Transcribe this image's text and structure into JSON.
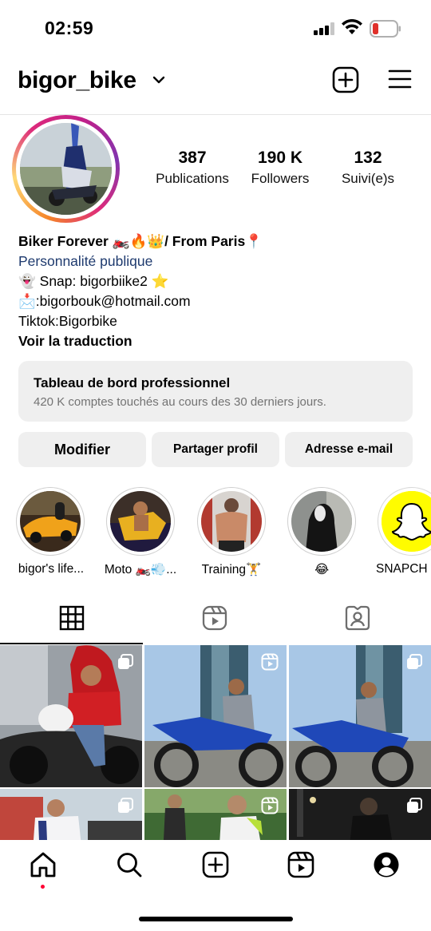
{
  "status_bar": {
    "time": "02:59"
  },
  "header": {
    "username": "bigor_bike"
  },
  "stats": [
    {
      "value": "387",
      "label": "Publications"
    },
    {
      "value": "190 K",
      "label": "Followers"
    },
    {
      "value": "132",
      "label": "Suivi(e)s"
    }
  ],
  "bio": {
    "name_line": "Biker Forever 🏍️🔥👑/ From Paris📍",
    "category": "Personnalité publique",
    "snap_line": "👻 Snap: bigorbiike2 ⭐",
    "email_line": "📩:bigorbouk@hotmail.com",
    "tiktok_line": "Tiktok:Bigorbike",
    "translate": "Voir la traduction"
  },
  "dashboard": {
    "title": "Tableau de bord professionnel",
    "subtitle": "420 K comptes touchés au cours des 30 derniers jours."
  },
  "buttons": {
    "edit": "Modifier",
    "share": "Partager profil",
    "email": "Adresse e-mail"
  },
  "highlights": [
    {
      "label": "bigor's life..."
    },
    {
      "label": "Moto 🏍️💨..."
    },
    {
      "label": "Training🏋️"
    },
    {
      "label": "😂"
    },
    {
      "label": "SNAPCH"
    }
  ],
  "tabs": [
    "grid-tab",
    "reels-tab",
    "tagged-tab"
  ],
  "colors": {
    "story_ring_gradient": [
      "#f58529",
      "#feda77",
      "#dd2a7b",
      "#8134af"
    ],
    "category_link": "#1e3a6e",
    "button_bg": "#efefef",
    "muted_text": "#737373",
    "notification_dot": "#ff0033",
    "battery_low": "#e0312b"
  },
  "icons": {
    "header": [
      "chevron-down-icon",
      "create-post-icon",
      "hamburger-menu-icon"
    ],
    "status": [
      "cellular-signal-icon",
      "wifi-icon",
      "battery-icon"
    ],
    "nav": [
      "home-icon",
      "search-icon",
      "create-icon",
      "reels-icon",
      "profile-icon"
    ],
    "grid_badges": [
      "carousel-icon",
      "reel-icon"
    ]
  }
}
